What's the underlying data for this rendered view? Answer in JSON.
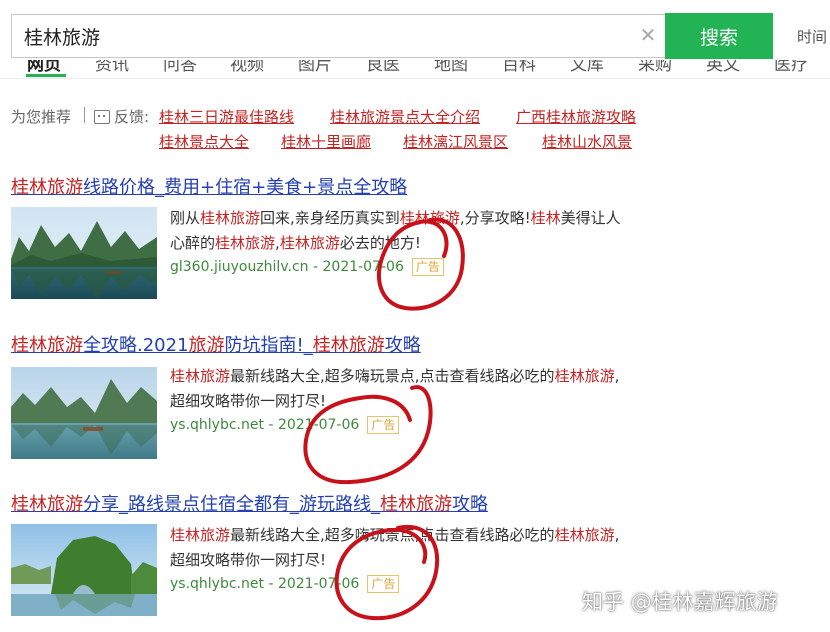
{
  "search": {
    "query": "桂林旅游",
    "button_label": "搜索",
    "time_filter": "时间"
  },
  "tabs": [
    "网页",
    "资讯",
    "问答",
    "视频",
    "图片",
    "良医",
    "地图",
    "百科",
    "文库",
    "采购",
    "英文",
    "医疗"
  ],
  "recommend": {
    "label": "为您推荐",
    "feedback": "反馈:",
    "links": [
      "桂林三日游最佳路线",
      "桂林旅游景点大全介绍",
      "广西桂林旅游攻略",
      "桂林景点大全",
      "桂林十里画廊",
      "桂林漓江风景区",
      "桂林山水风景"
    ]
  },
  "results": [
    {
      "title_parts": [
        {
          "text": "桂林旅游",
          "hl": true
        },
        {
          "text": "线路价格_费用+住宿+美食+景点全攻略",
          "hl": false
        }
      ],
      "snippet_line1": [
        {
          "text": "刚从",
          "hl": false
        },
        {
          "text": "桂林旅游",
          "hl": true
        },
        {
          "text": "回来,亲身经历真实到",
          "hl": false
        },
        {
          "text": "桂林旅游",
          "hl": true
        },
        {
          "text": ",分享攻略!",
          "hl": false
        },
        {
          "text": "桂林",
          "hl": true
        },
        {
          "text": "美得让人",
          "hl": false
        }
      ],
      "snippet_line2": [
        {
          "text": "心醉的",
          "hl": false
        },
        {
          "text": "桂林旅游",
          "hl": true
        },
        {
          "text": ",",
          "hl": false
        },
        {
          "text": "桂林旅游",
          "hl": true
        },
        {
          "text": "必去的地方!",
          "hl": false
        }
      ],
      "url": "gl360.jiuyouzhilv.cn",
      "date": "2021-07-06",
      "ad": "广告"
    },
    {
      "title_parts": [
        {
          "text": "桂林旅游",
          "hl": true
        },
        {
          "text": "全攻略.2021",
          "hl": false
        },
        {
          "text": "旅游",
          "hl": true
        },
        {
          "text": "防坑指南!_",
          "hl": false
        },
        {
          "text": "桂林旅游",
          "hl": true
        },
        {
          "text": "攻略",
          "hl": false
        }
      ],
      "snippet_line1": [
        {
          "text": "桂林旅游",
          "hl": true
        },
        {
          "text": "最新线路大全,超多嗨玩景点,点击查看线路必吃的",
          "hl": false
        },
        {
          "text": "桂林旅游",
          "hl": true
        },
        {
          "text": ",",
          "hl": false
        }
      ],
      "snippet_line2": [
        {
          "text": "超细攻略带你一网打尽!",
          "hl": false
        }
      ],
      "url": "ys.qhlybc.net",
      "date": "2021-07-06",
      "ad": "广告"
    },
    {
      "title_parts": [
        {
          "text": "桂林旅游",
          "hl": true
        },
        {
          "text": "分享_路线景点住宿全都有_游玩路线_",
          "hl": false
        },
        {
          "text": "桂林旅游",
          "hl": true
        },
        {
          "text": "攻略",
          "hl": false
        }
      ],
      "snippet_line1": [
        {
          "text": "桂林旅游",
          "hl": true
        },
        {
          "text": "最新线路大全,超多嗨玩景点,点击查看线路必吃的",
          "hl": false
        },
        {
          "text": "桂林旅游",
          "hl": true
        },
        {
          "text": ",",
          "hl": false
        }
      ],
      "snippet_line2": [
        {
          "text": "超细攻略带你一网打尽!",
          "hl": false
        }
      ],
      "url": "ys.qhlybc.net",
      "date": "2021-07-06",
      "ad": "广告"
    }
  ],
  "watermark": "知乎 @桂林嘉辉旅游",
  "colors": {
    "accent_green": "#21b354",
    "highlight_red": "#c62323",
    "link_blue": "#2440b3",
    "url_green": "#3d8a3d",
    "annotation_red": "#c8121b"
  }
}
